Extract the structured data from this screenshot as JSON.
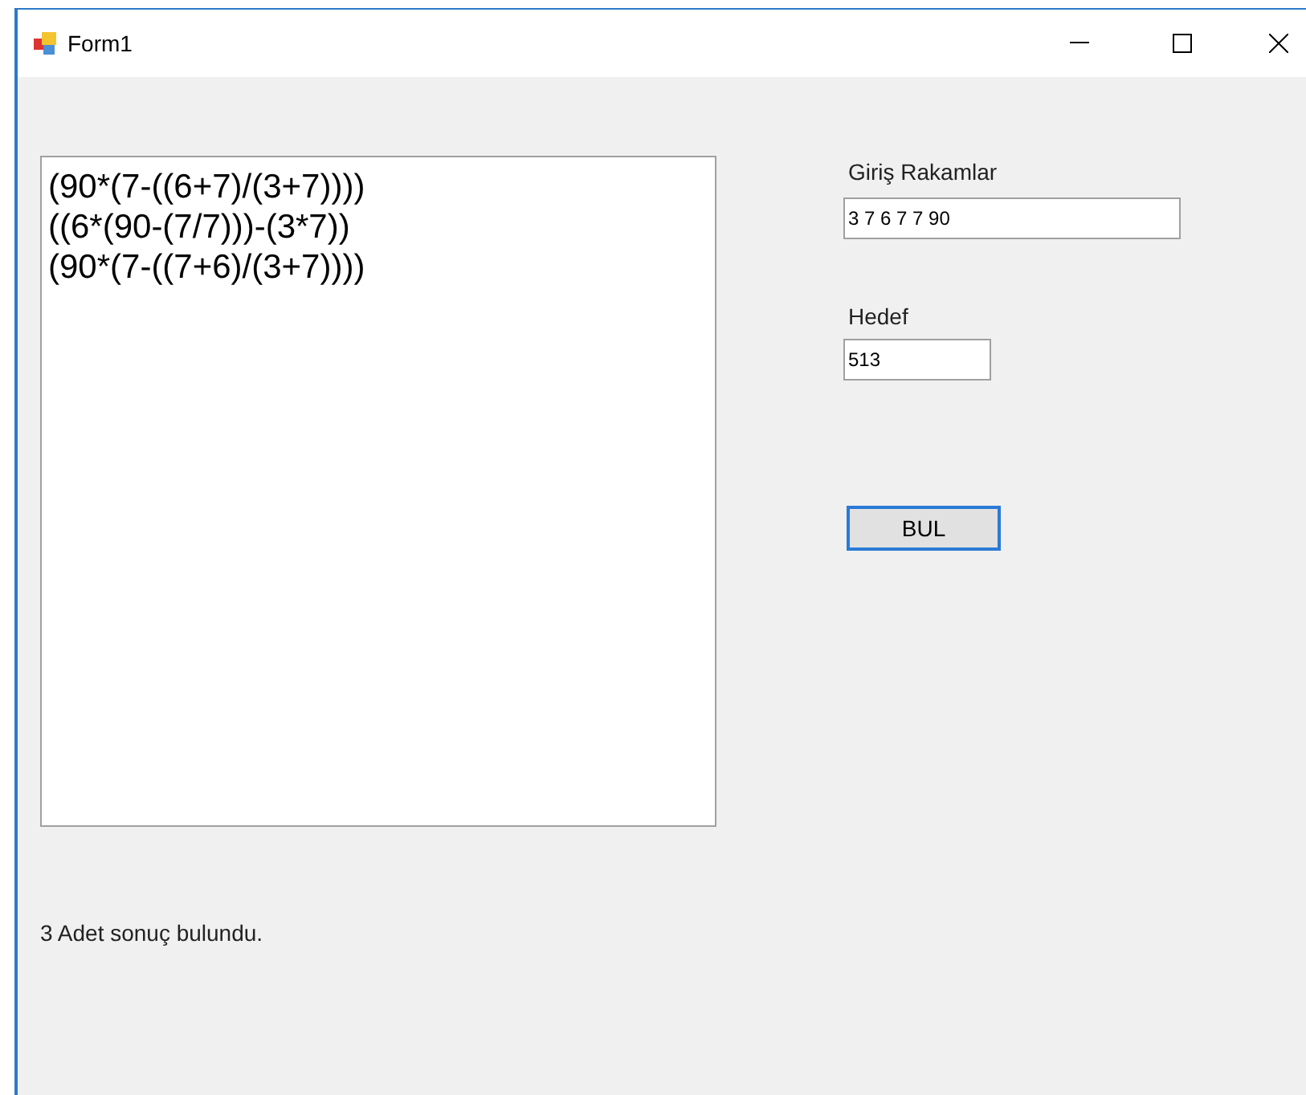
{
  "window": {
    "title": "Form1"
  },
  "results": [
    "(90*(7-((6+7)/(3+7))))",
    "((6*(90-(7/7)))-(3*7))",
    "(90*(7-((7+6)/(3+7))))"
  ],
  "input_label": "Giriş Rakamlar",
  "input_value": "3 7 6 7 7 90",
  "target_label": "Hedef",
  "target_value": "513",
  "find_button": "BUL",
  "status": "3 Adet sonuç bulundu."
}
